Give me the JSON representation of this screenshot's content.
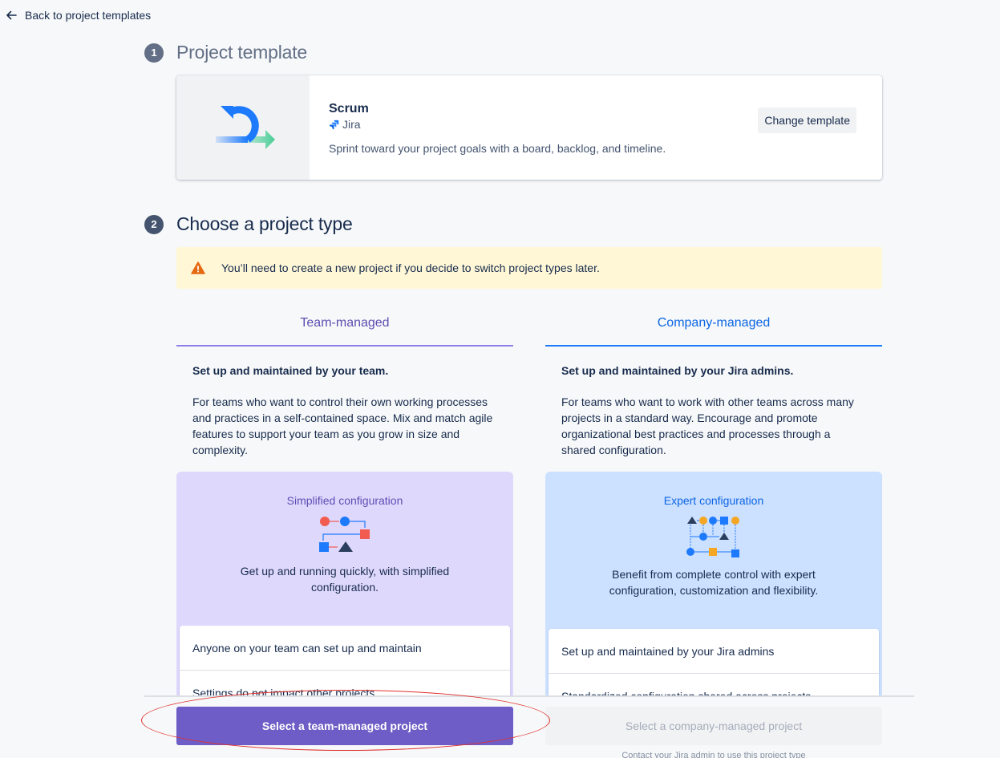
{
  "back_link": {
    "label": "Back to project templates",
    "icon": "arrow-left-icon"
  },
  "steps": [
    {
      "number": "1",
      "title": "Project template"
    },
    {
      "number": "2",
      "title": "Choose a project type"
    }
  ],
  "template": {
    "name": "Scrum",
    "app": "Jira",
    "description": "Sprint toward your project goals with a board, backlog, and timeline.",
    "change_label": "Change template"
  },
  "warning": {
    "icon": "warning-icon",
    "text": "You’ll need to create a new project if you decide to switch project types later."
  },
  "types": {
    "team": {
      "tab": "Team-managed",
      "subtitle": "Set up and maintained by your team.",
      "description": "For teams who want to control their own working processes and practices in a self-contained space. Mix and match agile features to support your team as you grow in size and complexity.",
      "config_title": "Simplified configuration",
      "config_desc": "Get up and running quickly, with simplified configuration.",
      "features": [
        "Anyone on your team can set up and maintain",
        "Settings do not impact other projects"
      ],
      "button": "Select a team-managed project"
    },
    "company": {
      "tab": "Company-managed",
      "subtitle": "Set up and maintained by your Jira admins.",
      "description": "For teams who want to work with other teams across many projects in a standard way. Encourage and promote organizational best practices and processes through a shared configuration.",
      "config_title": "Expert configuration",
      "config_desc": "Benefit from complete control with expert configuration, customization and flexibility.",
      "features": [
        "Set up and maintained by your Jira admins",
        "Standardized configuration shared across projects"
      ],
      "button": "Select a company-managed project",
      "note": "Contact your Jira admin to use this project type"
    }
  },
  "colors": {
    "team_accent": "#5e4db2",
    "company_accent": "#0c66e4",
    "primary_button": "#6e5dc6",
    "warning_bg": "#fff7d6",
    "annotation": "#e0302c"
  }
}
